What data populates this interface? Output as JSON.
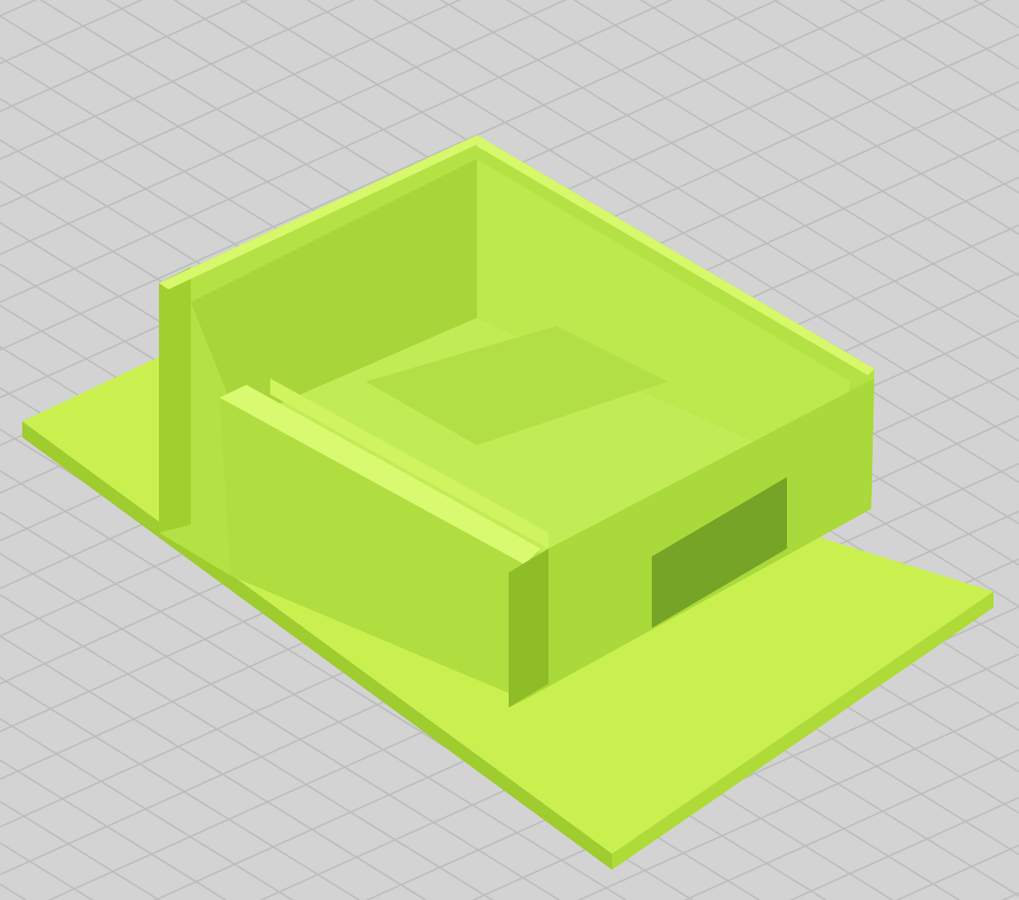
{
  "viewport": {
    "kind": "perspective",
    "grid": true
  }
}
